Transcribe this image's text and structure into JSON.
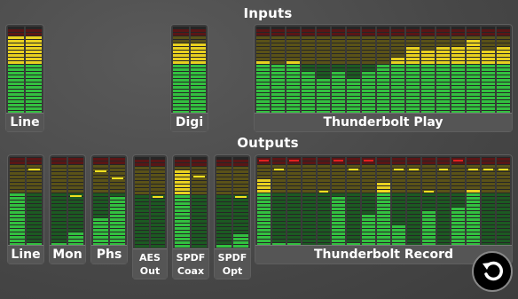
{
  "inputs_title": "Inputs",
  "outputs_title": "Outputs",
  "back_icon": "rotate-back-icon",
  "colors": {
    "green": "#33c040",
    "yellow": "#e8d020",
    "red": "#e02020",
    "peak": "#f0e020",
    "dim_green": "#1c5a22",
    "dim_yellow": "#5a5218",
    "dim_red": "#5a1616"
  },
  "inputs": [
    {
      "label": "Line",
      "meters": [
        0.92,
        0.92
      ]
    },
    {
      "label": "Digi",
      "meters": [
        0.85,
        0.85
      ]
    },
    {
      "label": "Thunderbolt Play",
      "meters": [
        0.63,
        0.58,
        0.63,
        0.48,
        0.43,
        0.48,
        0.43,
        0.48,
        0.58,
        0.68,
        0.78,
        0.73,
        0.78,
        0.78,
        0.88,
        0.73,
        0.78
      ]
    }
  ],
  "outputs": [
    {
      "label": "Line",
      "label2": "",
      "meters": [
        0.58,
        0.05
      ],
      "peaks": [
        0.0,
        0.85
      ]
    },
    {
      "label": "Mon",
      "label2": "",
      "meters": [
        0.05,
        0.15
      ],
      "peaks": [
        0.0,
        0.55
      ]
    },
    {
      "label": "Phs",
      "label2": "",
      "meters": [
        0.33,
        0.55
      ],
      "peaks": [
        0.83,
        0.75
      ]
    },
    {
      "label": "AES",
      "label2": "Out",
      "meters": [
        0.0,
        0.0
      ],
      "peaks": [
        0.0,
        0.55
      ]
    },
    {
      "label": "SPDF",
      "label2": "Coax",
      "meters": [
        0.88,
        0.0
      ],
      "peaks": [
        0.0,
        0.77
      ]
    },
    {
      "label": "SPDF",
      "label2": "Opt",
      "meters": [
        0.05,
        0.15
      ],
      "peaks": [
        0.0,
        0.55
      ]
    },
    {
      "label": "Thunderbolt Record",
      "label2": "",
      "meters": [
        0.75,
        0.05,
        0.05,
        0.0,
        0.0,
        0.55,
        0.05,
        0.35,
        0.7,
        0.25,
        0.0,
        0.4,
        0.0,
        0.45,
        0.65,
        0.0,
        0.0
      ],
      "peaks": [
        0.95,
        0.85,
        0.95,
        0.0,
        0.6,
        0.95,
        0.85,
        0.95,
        0.6,
        0.85,
        0.85,
        0.6,
        0.85,
        0.95,
        0.85,
        0.85,
        0.85
      ]
    }
  ]
}
